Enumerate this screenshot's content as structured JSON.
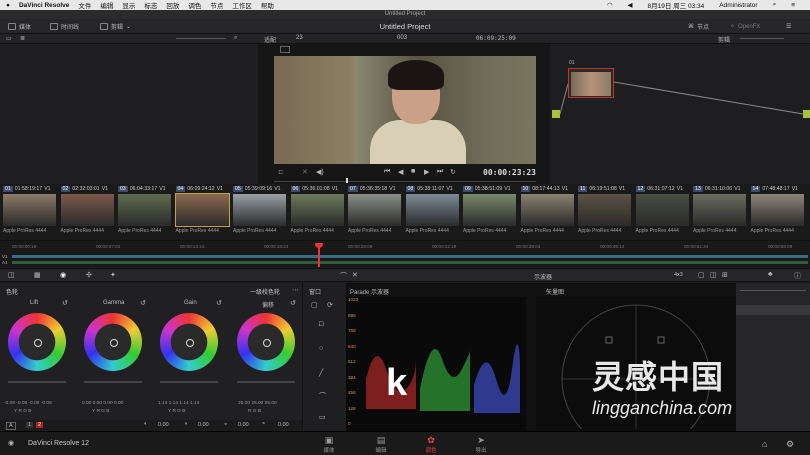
{
  "menubar": {
    "app": "DaVinci Resolve",
    "items": [
      "文件",
      "编辑",
      "显示",
      "标志",
      "回放",
      "调色",
      "节点",
      "工作区",
      "帮助"
    ],
    "datetime": "8月19日 周三 03:34",
    "user": "Administrator"
  },
  "window": {
    "title": "Untitled Project"
  },
  "toolbar": {
    "media": "媒体",
    "timeline": "时间线",
    "clips": "剪辑",
    "project": "Untitled Project",
    "nodes": "节点",
    "openfx": "OpenFX"
  },
  "viewerbar": {
    "fit": "适配",
    "zoom": "23",
    "clip_index": "003",
    "timecode": "06:09:25:09",
    "mode": "剪辑"
  },
  "viewer": {
    "timecode": "00:00:23:23"
  },
  "node": {
    "label": "01"
  },
  "clips": [
    {
      "num": "01",
      "tc": "01:58:19:17",
      "track": "V1",
      "fmt": "Apple ProRes 4444"
    },
    {
      "num": "02",
      "tc": "02:32:03:01",
      "track": "V1",
      "fmt": "Apple ProRes 4444"
    },
    {
      "num": "03",
      "tc": "06:04:33:17",
      "track": "V1",
      "fmt": "Apple ProRes 4444"
    },
    {
      "num": "04",
      "tc": "06:09:24:12",
      "track": "V1",
      "fmt": "Apple ProRes 4444"
    },
    {
      "num": "05",
      "tc": "05:39:09:16",
      "track": "V1",
      "fmt": "Apple ProRes 4444"
    },
    {
      "num": "06",
      "tc": "05:36:01:08",
      "track": "V1",
      "fmt": "Apple ProRes 4444"
    },
    {
      "num": "07",
      "tc": "05:36:35:18",
      "track": "V1",
      "fmt": "Apple ProRes 4444"
    },
    {
      "num": "08",
      "tc": "05:38:11:07",
      "track": "V1",
      "fmt": "Apple ProRes 4444"
    },
    {
      "num": "09",
      "tc": "05:38:51:09",
      "track": "V1",
      "fmt": "Apple ProRes 4444"
    },
    {
      "num": "10",
      "tc": "08:17:44:13",
      "track": "V1",
      "fmt": "Apple ProRes 4444"
    },
    {
      "num": "11",
      "tc": "06:19:51:08",
      "track": "V1",
      "fmt": "Apple ProRes 4444"
    },
    {
      "num": "12",
      "tc": "06:31:07:12",
      "track": "V1",
      "fmt": "Apple ProRes 4444"
    },
    {
      "num": "13",
      "tc": "06:31:10:06",
      "track": "V1",
      "fmt": "Apple ProRes 4444"
    },
    {
      "num": "14",
      "tc": "07:48:48:17",
      "track": "V1",
      "fmt": "Apple ProRes 4444"
    }
  ],
  "ruler": [
    "00:00:00:19",
    "00:00:07:04",
    "00:00:13:14",
    "00:00:19:24",
    "00:00:26:09",
    "00:00:32:19",
    "00:00:39:04",
    "00:00:45:14",
    "00:00:51:24",
    "00:00:58:09"
  ],
  "tracks": {
    "v": "V1",
    "a": "A1"
  },
  "colorpanel": {
    "title": "色轮",
    "mode": "一级校色轮",
    "wheels": [
      {
        "name": "Lift",
        "vals": "-0.08  -0.08  -0.08  -0.08",
        "ch": "Y  R  G  B"
      },
      {
        "name": "Gamma",
        "vals": "0.00  0.00  0.00  0.00",
        "ch": "Y  R  G  B"
      },
      {
        "name": "Gain",
        "vals": "1.14  1.14  1.14  1.14",
        "ch": "Y  R  G  B"
      },
      {
        "name": "偏移",
        "vals": "25.00  25.00  25.00",
        "ch": "R  G  B"
      }
    ],
    "bottom": {
      "a": "A",
      "v1": "1",
      "v2": "2",
      "c1": "0.00",
      "c2": "0.00",
      "c3": "0.00",
      "c4": "0.00"
    }
  },
  "windowpanel": {
    "title": "窗口"
  },
  "scopes": {
    "title": "示波器",
    "parade": "Parade 示波器",
    "vector": "矢量图",
    "scale": [
      "1023",
      "896",
      "768",
      "640",
      "512",
      "384",
      "256",
      "128",
      "0"
    ],
    "ratio": "4x3"
  },
  "watermark": {
    "letter": "k",
    "title": "灵感中国",
    "url": "lingganchina.com"
  },
  "footer": {
    "app": "DaVinci Resolve 12",
    "nav": [
      {
        "label": "媒体",
        "glyph": "▣"
      },
      {
        "label": "编辑",
        "glyph": "▤"
      },
      {
        "label": "调色",
        "glyph": "✿"
      },
      {
        "label": "导出",
        "glyph": "➤"
      }
    ]
  }
}
